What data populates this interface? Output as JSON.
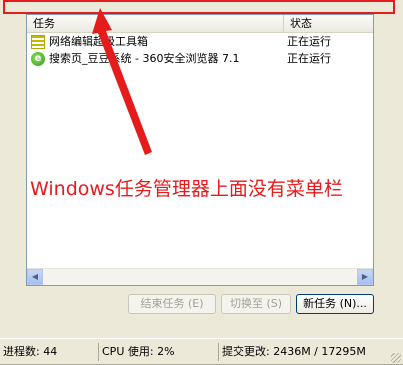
{
  "listview": {
    "columns": {
      "task": "任务",
      "status": "状态"
    },
    "rows": [
      {
        "icon": "toolbox-icon",
        "name": "网络编辑超级工具箱",
        "status": "正在运行"
      },
      {
        "icon": "browser-360-icon",
        "name": "搜索页_豆豆系统 - 360安全浏览器 7.1",
        "status": "正在运行"
      }
    ]
  },
  "buttons": {
    "end_task": "结束任务 (E)",
    "switch_to": "切换至 (S)",
    "new_task": "新任务 (N)..."
  },
  "statusbar": {
    "processes": "进程数: 44",
    "cpu": "CPU 使用: 2%",
    "commit": "提交更改: 2436M / 17295M"
  },
  "annotation": {
    "text": "Windows任务管理器上面没有菜单栏",
    "color": "#e41c1c"
  },
  "colors": {
    "accent_red": "#e41c1c",
    "window_bg": "#ece9d8"
  }
}
